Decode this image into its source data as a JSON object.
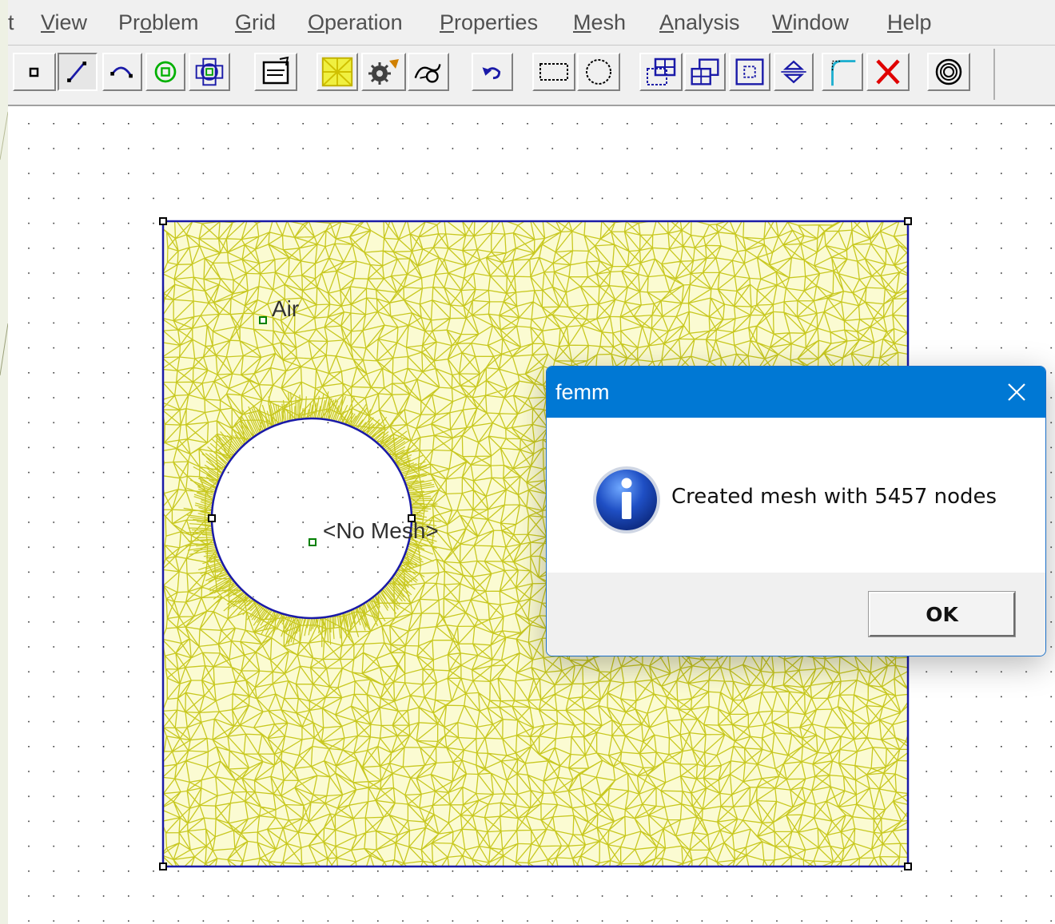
{
  "menubar": {
    "items": [
      {
        "prefix": "t",
        "mnemonic": "",
        "rest": ""
      },
      {
        "prefix": "",
        "mnemonic": "V",
        "rest": "iew"
      },
      {
        "prefix": "Pr",
        "mnemonic": "o",
        "rest": "blem"
      },
      {
        "prefix": "",
        "mnemonic": "G",
        "rest": "rid"
      },
      {
        "prefix": "",
        "mnemonic": "O",
        "rest": "peration"
      },
      {
        "prefix": "",
        "mnemonic": "P",
        "rest": "roperties"
      },
      {
        "prefix": "",
        "mnemonic": "M",
        "rest": "esh"
      },
      {
        "prefix": "",
        "mnemonic": "A",
        "rest": "nalysis"
      },
      {
        "prefix": "",
        "mnemonic": "W",
        "rest": "indow"
      },
      {
        "prefix": "",
        "mnemonic": "H",
        "rest": "elp"
      }
    ]
  },
  "toolbar": {
    "buttons": [
      {
        "name": "operate-on-nodes-icon",
        "pressed": false
      },
      {
        "name": "operate-on-segments-icon",
        "pressed": true
      },
      {
        "name": "operate-on-arcs-icon",
        "pressed": false
      },
      {
        "name": "operate-on-block-labels-icon",
        "pressed": false
      },
      {
        "name": "operate-on-groups-icon",
        "pressed": false
      },
      {
        "name": "problem-properties-icon",
        "pressed": false
      },
      {
        "name": "create-mesh-icon",
        "pressed": false
      },
      {
        "name": "run-analysis-icon",
        "pressed": false
      },
      {
        "name": "view-results-icon",
        "pressed": false
      },
      {
        "name": "undo-icon",
        "pressed": false
      },
      {
        "name": "select-rectangle-icon",
        "pressed": false
      },
      {
        "name": "select-circle-icon",
        "pressed": false
      },
      {
        "name": "move-icon",
        "pressed": false
      },
      {
        "name": "copy-icon",
        "pressed": false
      },
      {
        "name": "scale-icon",
        "pressed": false
      },
      {
        "name": "mirror-icon",
        "pressed": false
      },
      {
        "name": "fillet-icon",
        "pressed": false
      },
      {
        "name": "delete-icon",
        "pressed": false
      },
      {
        "name": "open-boundary-icon",
        "pressed": false
      }
    ]
  },
  "canvas": {
    "block_labels": {
      "air": "Air",
      "no_mesh": "<No Mesh>"
    },
    "mesh_color": "#c8c820",
    "geometry_color": "#1a1aa8",
    "label_marker_color": "#008000"
  },
  "dialog": {
    "title": "femm",
    "message": "Created mesh with 5457 nodes",
    "ok_label": "OK",
    "icon": "information-icon",
    "accent": "#0078d4"
  }
}
